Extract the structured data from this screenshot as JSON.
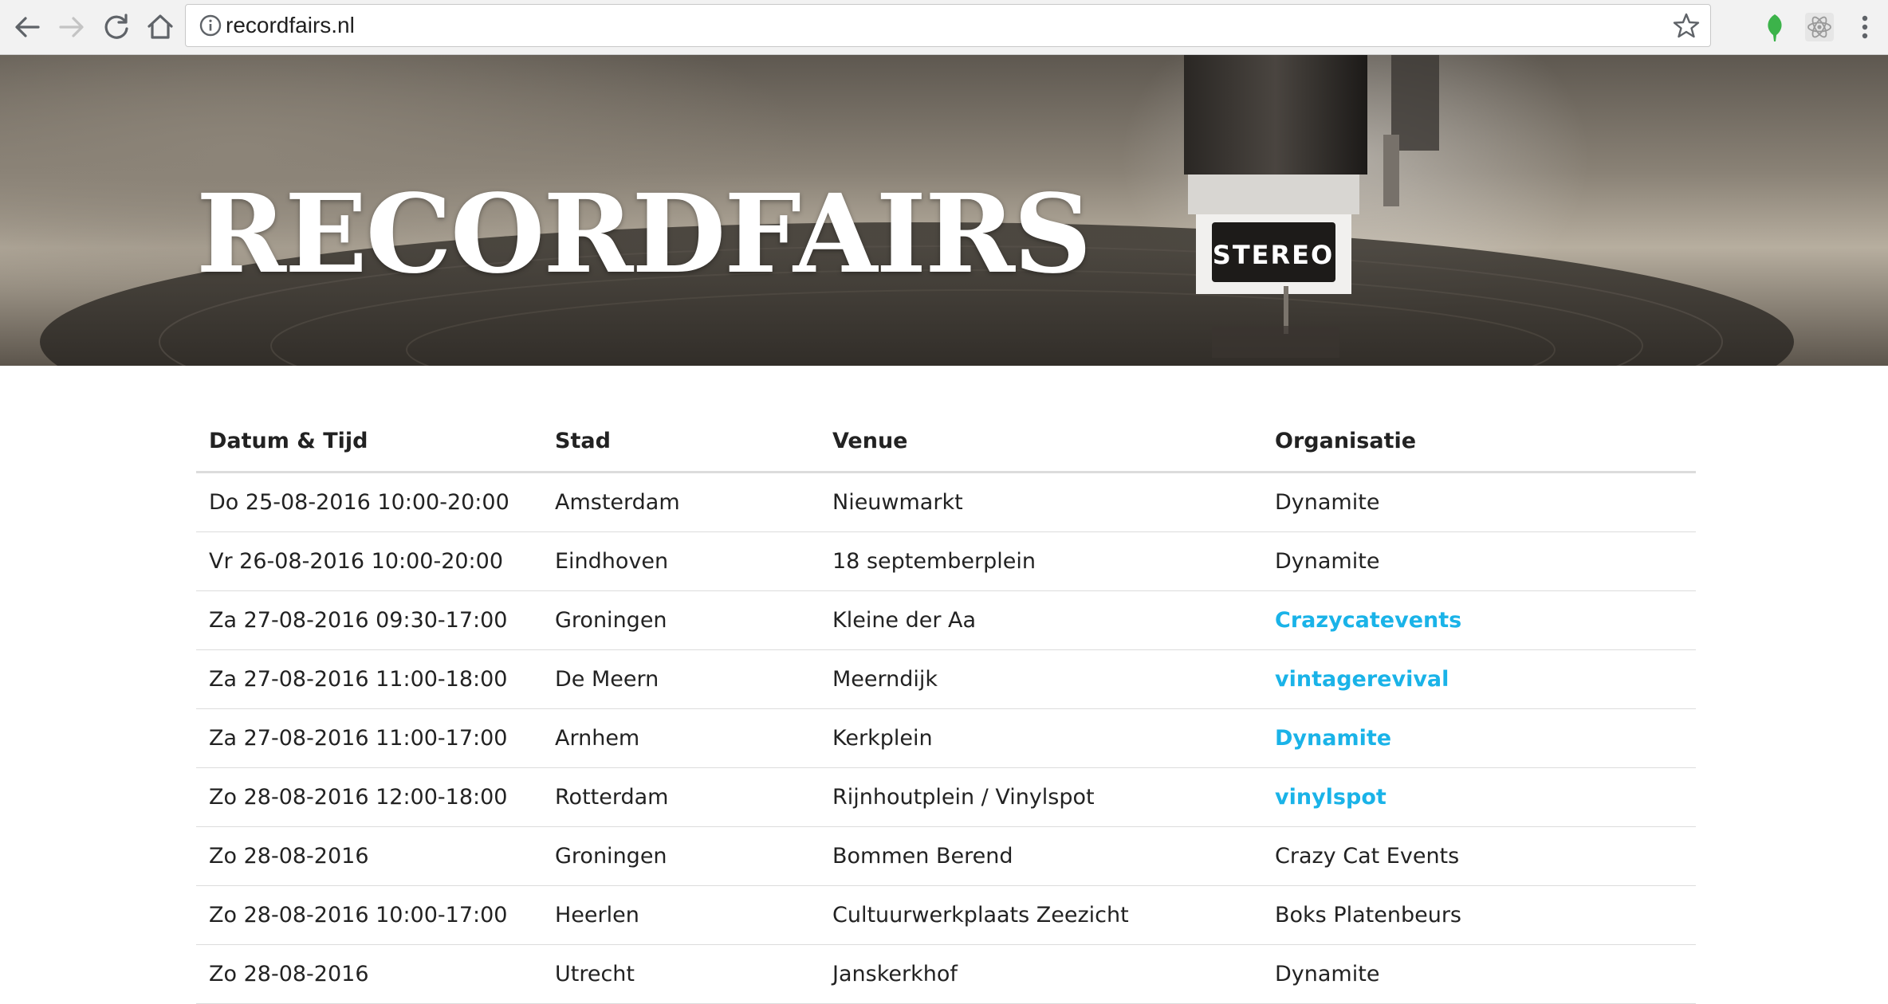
{
  "browser": {
    "url": "recordfairs.nl"
  },
  "hero": {
    "title": "RECORDFAIRS",
    "cartridge_label": "STEREO"
  },
  "colors": {
    "link": "#1ab3e8",
    "text": "#222222",
    "divider": "#dcdcdc"
  },
  "table": {
    "headers": {
      "date": "Datum & Tijd",
      "city": "Stad",
      "venue": "Venue",
      "org": "Organisatie"
    },
    "rows": [
      {
        "date": "Do 25-08-2016 10:00-20:00",
        "city": "Amsterdam",
        "venue": "Nieuwmarkt",
        "org": "Dynamite",
        "org_is_link": false
      },
      {
        "date": "Vr 26-08-2016 10:00-20:00",
        "city": "Eindhoven",
        "venue": "18 septemberplein",
        "org": "Dynamite",
        "org_is_link": false
      },
      {
        "date": "Za 27-08-2016 09:30-17:00",
        "city": "Groningen",
        "venue": "Kleine der Aa",
        "org": "Crazycatevents",
        "org_is_link": true
      },
      {
        "date": "Za 27-08-2016 11:00-18:00",
        "city": "De Meern",
        "venue": "Meerndijk",
        "org": "vintagerevival",
        "org_is_link": true
      },
      {
        "date": "Za 27-08-2016 11:00-17:00",
        "city": "Arnhem",
        "venue": "Kerkplein",
        "org": "Dynamite",
        "org_is_link": true
      },
      {
        "date": "Zo 28-08-2016 12:00-18:00",
        "city": "Rotterdam",
        "venue": "Rijnhoutplein / Vinylspot",
        "org": "vinylspot",
        "org_is_link": true
      },
      {
        "date": "Zo 28-08-2016",
        "city": "Groningen",
        "venue": "Bommen Berend",
        "org": "Crazy Cat Events",
        "org_is_link": false
      },
      {
        "date": "Zo 28-08-2016 10:00-17:00",
        "city": "Heerlen",
        "venue": "Cultuurwerkplaats Zeezicht",
        "org": "Boks Platenbeurs",
        "org_is_link": false
      },
      {
        "date": "Zo 28-08-2016",
        "city": "Utrecht",
        "venue": "Janskerkhof",
        "org": "Dynamite",
        "org_is_link": false
      }
    ]
  }
}
